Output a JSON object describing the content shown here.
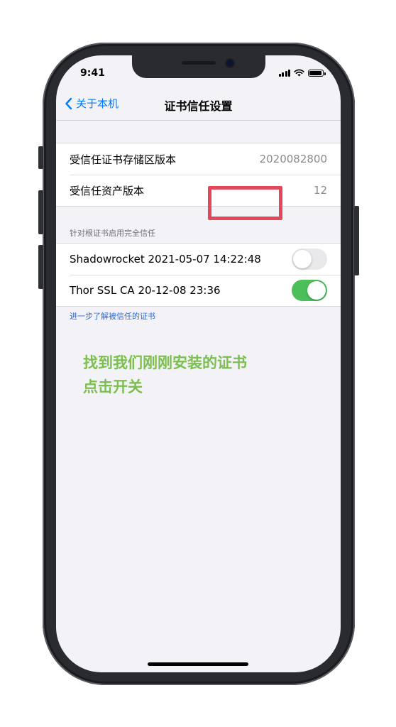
{
  "status_bar": {
    "time": "9:41"
  },
  "nav": {
    "back_label": "关于本机",
    "title": "证书信任设置"
  },
  "trust_store": {
    "rows": [
      {
        "label": "受信任证书存储区版本",
        "value": "2020082800"
      },
      {
        "label": "受信任资产版本",
        "value": "12"
      }
    ]
  },
  "full_trust": {
    "header": "针对根证书启用完全信任",
    "certificates": [
      {
        "name": "Shadowrocket 2021-05-07 14:22:48",
        "enabled": false
      },
      {
        "name": "Thor SSL CA 20-12-08 23:36",
        "enabled": true
      }
    ],
    "footer_link": "进一步了解被信任的证书"
  },
  "annotation": {
    "line1": "找到我们刚刚安装的证书",
    "line2": "点击开关",
    "color": "#7cbf4f"
  },
  "colors": {
    "accent": "#007aff",
    "toggle_on": "#4cbf5a",
    "highlight": "#e3475a"
  }
}
